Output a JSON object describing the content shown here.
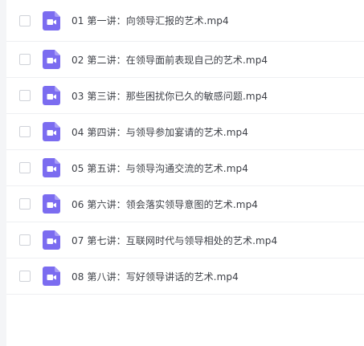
{
  "accent_color": "#7b6cf0",
  "files": [
    {
      "name": "01 第一讲：向领导汇报的艺术.mp4",
      "icon": "video-file-icon"
    },
    {
      "name": "02 第二讲：在领导面前表现自己的艺术.mp4",
      "icon": "video-file-icon"
    },
    {
      "name": "03 第三讲：那些困扰你已久的敏感问题.mp4",
      "icon": "video-file-icon"
    },
    {
      "name": "04 第四讲：与领导参加宴请的艺术.mp4",
      "icon": "video-file-icon"
    },
    {
      "name": "05 第五讲：与领导沟通交流的艺术.mp4",
      "icon": "video-file-icon"
    },
    {
      "name": "06 第六讲：领会落实领导意图的艺术.mp4",
      "icon": "video-file-icon"
    },
    {
      "name": "07 第七讲：互联网时代与领导相处的艺术.mp4",
      "icon": "video-file-icon"
    },
    {
      "name": "08 第八讲：写好领导讲话的艺术.mp4",
      "icon": "video-file-icon"
    }
  ]
}
